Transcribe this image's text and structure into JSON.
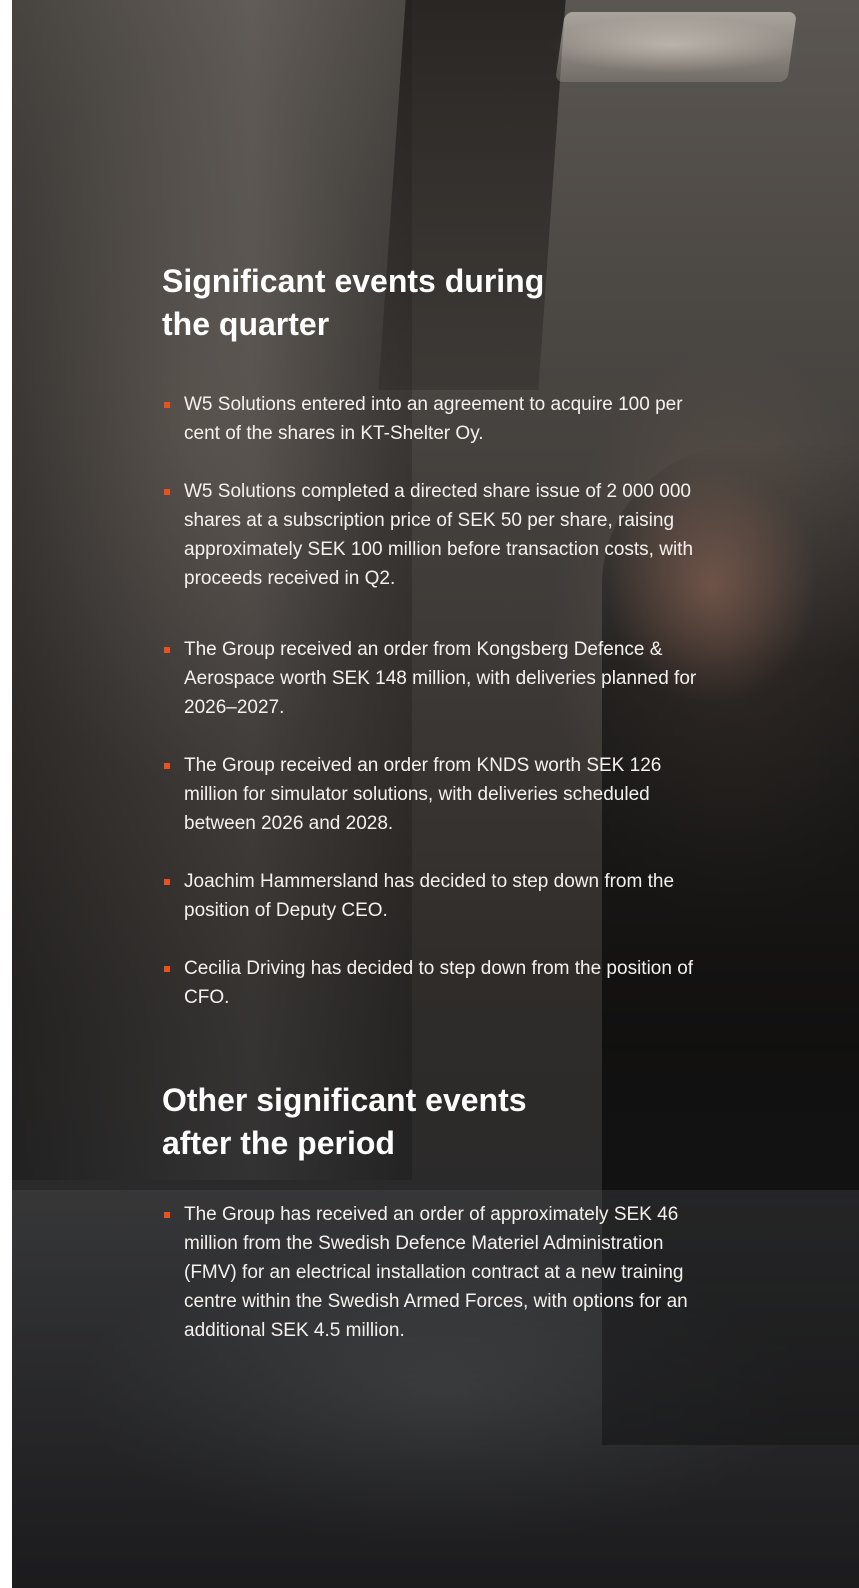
{
  "section_quarter": {
    "heading": "Significant events during the quarter",
    "items": [
      "W5 Solutions entered into an agreement to acquire 100 per cent of the shares in KT-Shelter Oy.",
      "W5 Solutions completed a directed share issue of 2 000 000 shares at a subscription price of SEK 50 per share, raising approximately SEK 100 million before transaction costs, with proceeds received in Q2.",
      "The Group received an order from Kongsberg Defence & Aerospace worth SEK 148 million, with deliveries planned for 2026–2027.",
      "The Group received an order from KNDS worth SEK 126 million for simulator solutions, with deliveries scheduled between 2026 and 2028.",
      "Joachim Hammersland has decided to step down from the position of Deputy CEO.",
      "Cecilia Driving has decided to step down from the position of CFO."
    ]
  },
  "section_after": {
    "heading": "Other significant events after the period",
    "items": [
      "The Group has received an order of approximately SEK 46 million from the Swedish Defence Materiel Administration (FMV) for an electrical installation contract at a new training centre within the Swedish Armed Forces, with options for an additional SEK 4.5 million."
    ]
  },
  "colors": {
    "bullet": "#e8521f",
    "text": "#ffffff"
  }
}
